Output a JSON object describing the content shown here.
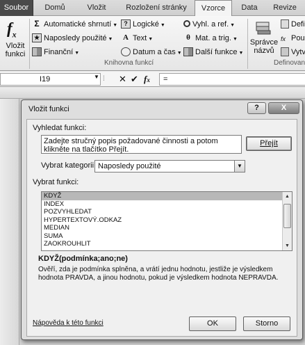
{
  "tabs": [
    "Soubor",
    "Domů",
    "Vložit",
    "Rozložení stránky",
    "Vzorce",
    "Data",
    "Revize"
  ],
  "active_tab": "Vzorce",
  "ribbon": {
    "insert_function": [
      "Vložit",
      "funkci"
    ],
    "col1": [
      "Automatické shrnutí",
      "Naposledy použité",
      "Finanční"
    ],
    "col2": [
      "Logické",
      "Text",
      "Datum a čas"
    ],
    "col3": [
      "Vyhl. a ref.",
      "Mat. a trig.",
      "Další funkce"
    ],
    "manager": [
      "Správce",
      "názvů"
    ],
    "defined": [
      "Defi",
      "Pou",
      "Vytv"
    ],
    "group_library": "Knihovna funkcí",
    "group_defined": "Definovan"
  },
  "formula_bar": {
    "name_box": "I19",
    "formula": "="
  },
  "dialog": {
    "title": "Vložit funkci",
    "help_btn": "?",
    "close_btn": "X",
    "search_label": "Vyhledat funkci:",
    "search_value": "Zadejte stručný popis požadované činnosti a potom klikněte na tlačítko Přejít.",
    "go_button": "Přejít",
    "category_label": "Vybrat kategorii:",
    "category_value": "Naposledy použité",
    "function_label": "Vybrat funkci:",
    "functions": [
      "KDYŽ",
      "INDEX",
      "POZVYHLEDAT",
      "HYPERTEXTOVÝ.ODKAZ",
      "MEDIAN",
      "SUMA",
      "ZAOKROUHLIT"
    ],
    "selected_function": "KDYŽ",
    "syntax": "KDYŽ(podmínka;ano;ne)",
    "description": "Ověří, zda je podmínka splněna, a vrátí jednu hodnotu, jestliže je výsledkem hodnota PRAVDA, a jinou hodnotu, pokud je výsledkem hodnota NEPRAVDA.",
    "help_link": "Nápověda k této funkci",
    "ok_button": "OK",
    "cancel_button": "Storno"
  }
}
